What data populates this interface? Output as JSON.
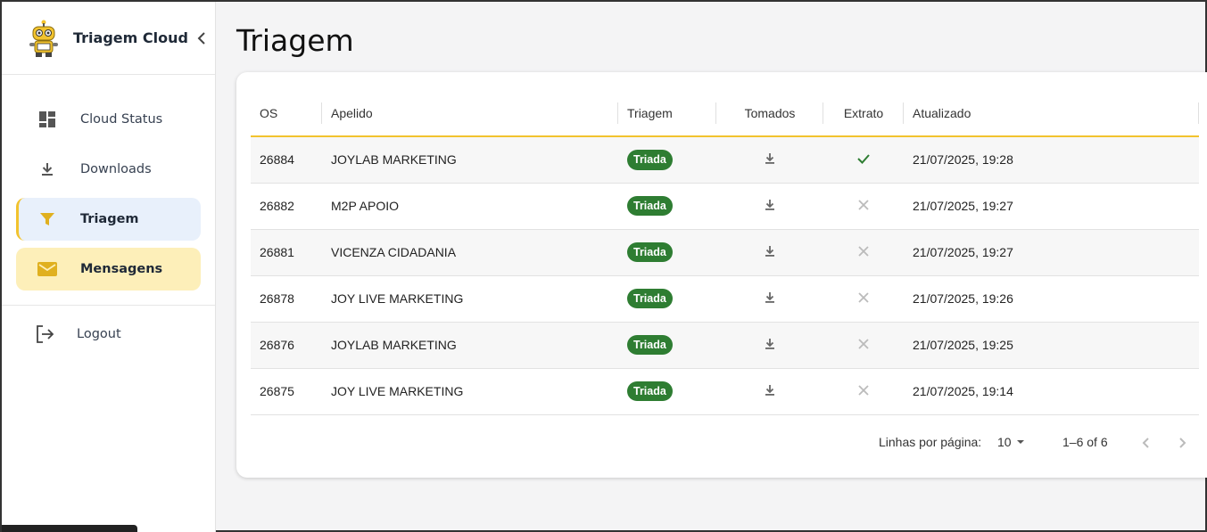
{
  "app": {
    "title": "Triagem Cloud"
  },
  "sidebar": {
    "items": [
      {
        "label": "Cloud Status",
        "icon": "dashboard-icon"
      },
      {
        "label": "Downloads",
        "icon": "download-icon"
      },
      {
        "label": "Triagem",
        "icon": "filter-icon",
        "active": true
      },
      {
        "label": "Mensagens",
        "icon": "mail-icon"
      }
    ],
    "logout": "Logout"
  },
  "page": {
    "title": "Triagem"
  },
  "table": {
    "headers": {
      "os": "OS",
      "apelido": "Apelido",
      "triagem": "Triagem",
      "tomados": "Tomados",
      "extrato": "Extrato",
      "atualizado": "Atualizado"
    },
    "rows": [
      {
        "os": "26884",
        "apelido": "JOYLAB MARKETING",
        "triagem": "Triada",
        "extrato": "check",
        "atualizado": "21/07/2025, 19:28"
      },
      {
        "os": "26882",
        "apelido": "M2P APOIO",
        "triagem": "Triada",
        "extrato": "x",
        "atualizado": "21/07/2025, 19:27"
      },
      {
        "os": "26881",
        "apelido": "VICENZA CIDADANIA",
        "triagem": "Triada",
        "extrato": "x",
        "atualizado": "21/07/2025, 19:27"
      },
      {
        "os": "26878",
        "apelido": "JOY LIVE MARKETING",
        "triagem": "Triada",
        "extrato": "x",
        "atualizado": "21/07/2025, 19:26"
      },
      {
        "os": "26876",
        "apelido": "JOYLAB MARKETING",
        "triagem": "Triada",
        "extrato": "x",
        "atualizado": "21/07/2025, 19:25"
      },
      {
        "os": "26875",
        "apelido": "JOY LIVE MARKETING",
        "triagem": "Triada",
        "extrato": "x",
        "atualizado": "21/07/2025, 19:14"
      }
    ]
  },
  "pagination": {
    "rows_label": "Linhas por página:",
    "rows_value": "10",
    "range": "1–6 of 6"
  },
  "colors": {
    "accent": "#f2c32e",
    "badge": "#2e7d32",
    "active_bg": "#e8f0fb",
    "highlight_bg": "#fdefb9"
  }
}
